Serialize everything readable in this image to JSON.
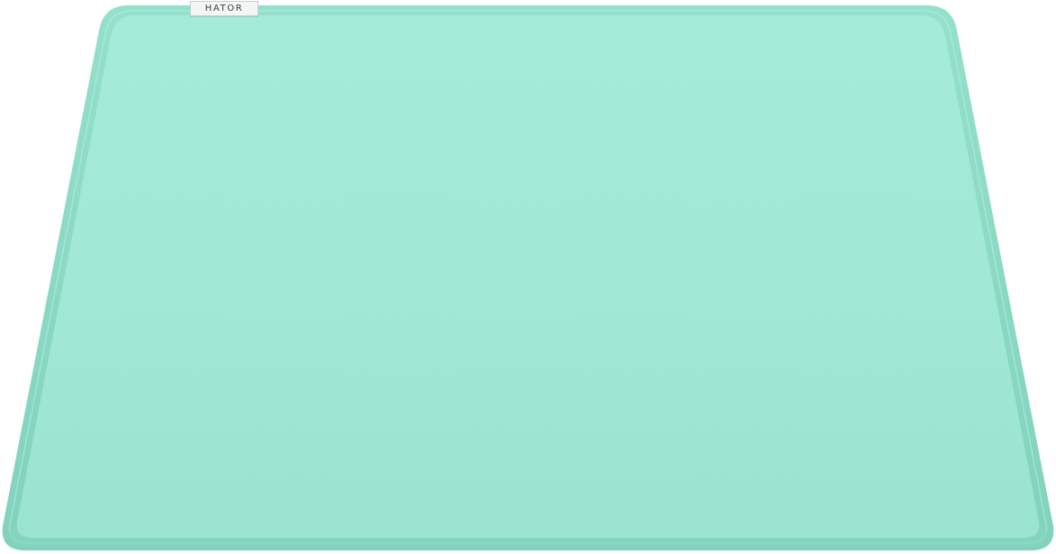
{
  "product": {
    "brand_label": "HATOR"
  },
  "colors": {
    "pad_surface": "#9fe9d6",
    "pad_edge_stitch": "#8fdcc6",
    "pad_edge_shadow": "#7fcdb6",
    "tag_background": "#f4f6f5",
    "tag_text": "#3a3f3d"
  }
}
